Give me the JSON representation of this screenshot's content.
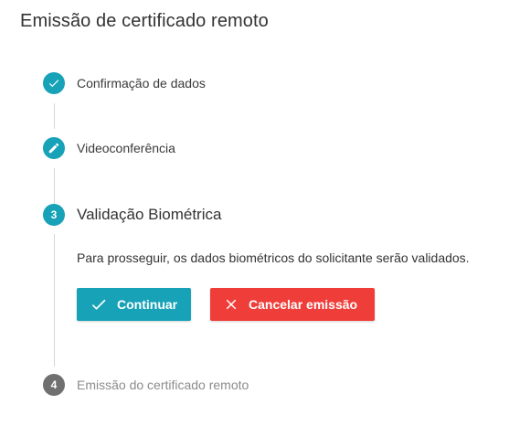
{
  "page": {
    "title": "Emissão de certificado remoto"
  },
  "stepper": {
    "steps": [
      {
        "label": "Confirmação de dados",
        "state": "completed",
        "icon": "check-icon"
      },
      {
        "label": "Videoconferência",
        "state": "editable",
        "icon": "pencil-icon"
      },
      {
        "label": "Validação Biométrica",
        "state": "active",
        "number": "3"
      },
      {
        "label": "Emissão do certificado remoto",
        "state": "pending",
        "number": "4"
      }
    ],
    "active_step": {
      "description": "Para prosseguir, os dados biométricos do solicitante serão validados.",
      "continue_label": "Continuar",
      "cancel_label": "Cancelar emissão"
    }
  },
  "colors": {
    "accent": "#17a2b8",
    "danger": "#ef3e3a",
    "pending": "#707070",
    "connector": "#d6d6d6"
  }
}
